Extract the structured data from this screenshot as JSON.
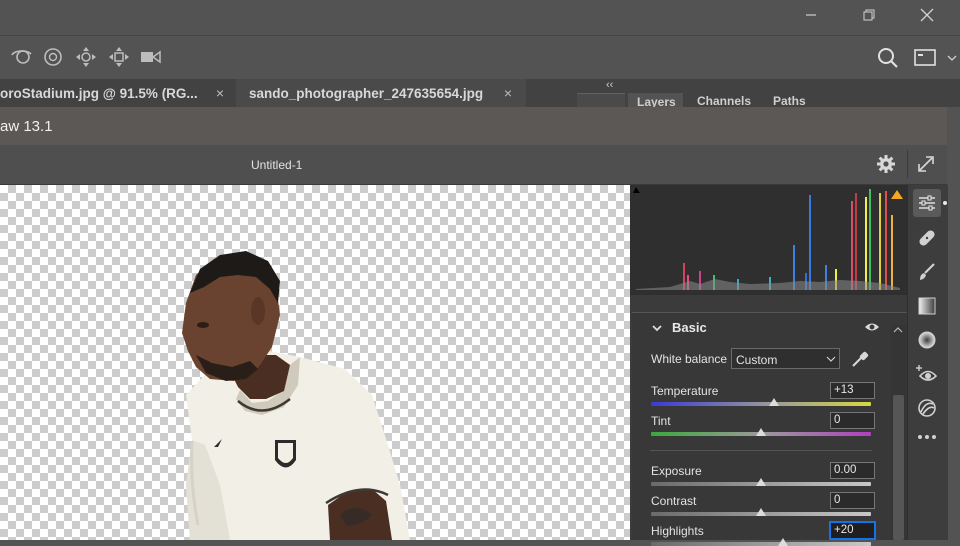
{
  "window": {
    "minimize_icon": "minimize-icon",
    "restore_icon": "restore-icon",
    "close_icon": "close-icon"
  },
  "options_bar": {
    "tools": [
      "rotate-3d-icon",
      "roll-3d-icon",
      "drag-3d-icon",
      "slide-3d-icon",
      "scale-3d-video-icon"
    ],
    "search_icon": "search-icon",
    "workspace_icon": "workspace-icon"
  },
  "doc_tabs": [
    {
      "label": "oroStadium.jpg @ 91.5% (RG...",
      "close": "×"
    },
    {
      "label": "sando_photographer_247635654.jpg",
      "close": "×"
    }
  ],
  "panel_tabs": [
    "Layers",
    "Channels",
    "Paths"
  ],
  "panel_collapse": "‹‹",
  "dialog": {
    "title": "aw 13.1",
    "document_name": "Untitled-1"
  },
  "basic": {
    "section_title": "Basic",
    "white_balance_label": "White balance",
    "white_balance_value": "Custom",
    "sliders": [
      {
        "label": "Temperature",
        "value": "+13",
        "position": 0.56,
        "track": "temperature"
      },
      {
        "label": "Tint",
        "value": "0",
        "position": 0.5,
        "track": "tint"
      },
      {
        "label": "Exposure",
        "value": "0.00",
        "position": 0.5,
        "track": "gray"
      },
      {
        "label": "Contrast",
        "value": "0",
        "position": 0.5,
        "track": "gray"
      },
      {
        "label": "Highlights",
        "value": "+20",
        "position": 0.6,
        "track": "gray"
      }
    ]
  },
  "right_tools": [
    "edit-sliders-icon",
    "healing-icon",
    "brush-icon",
    "linear-gradient-icon",
    "radial-filter-icon",
    "red-eye-icon",
    "presets-icon",
    "more-icon"
  ],
  "colors": {
    "accent": "#1473e6",
    "app_bg": "#535353",
    "dialog_title_bg": "#5b5855"
  }
}
